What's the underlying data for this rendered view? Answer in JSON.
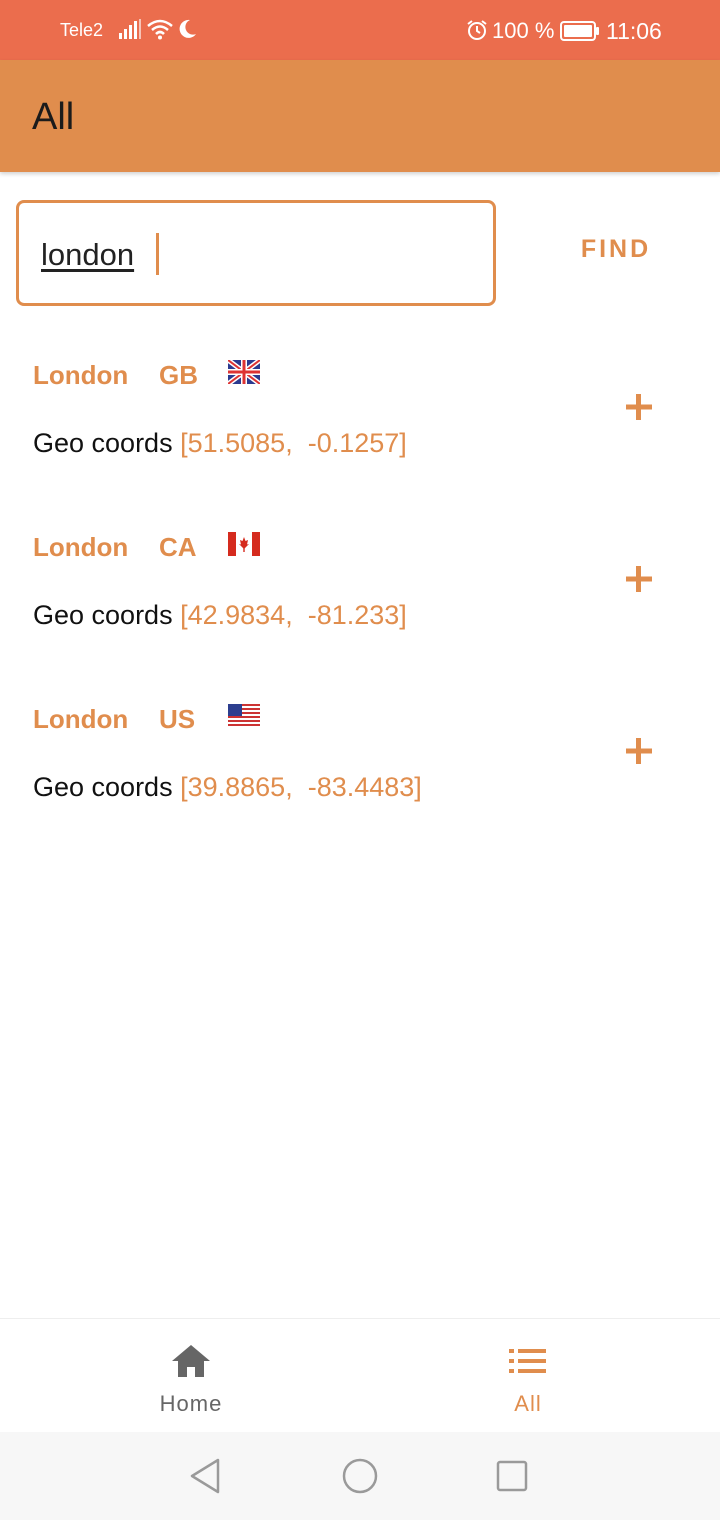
{
  "status_bar": {
    "carrier": "Tele2",
    "battery": "100 %",
    "time": "11:06",
    "icons": [
      "signal-icon",
      "wifi-icon",
      "moon-icon",
      "alarm-icon",
      "battery-icon"
    ]
  },
  "app_bar": {
    "title": "All"
  },
  "search": {
    "value": "london",
    "find_label": "FIND"
  },
  "results": [
    {
      "city": "London",
      "country": "GB",
      "coords_label": "Geo coords",
      "coords": "[51.5085,  -0.1257]",
      "flag": "uk-flag-icon"
    },
    {
      "city": "London",
      "country": "CA",
      "coords_label": "Geo coords",
      "coords": "[42.9834,  -81.233]",
      "flag": "canada-flag-icon"
    },
    {
      "city": "London",
      "country": "US",
      "coords_label": "Geo coords",
      "coords": "[39.8865,  -83.4483]",
      "flag": "us-flag-icon"
    }
  ],
  "bottom_nav": {
    "items": [
      {
        "label": "Home",
        "icon": "home-icon",
        "active": false
      },
      {
        "label": "All",
        "icon": "list-icon",
        "active": true
      }
    ]
  },
  "colors": {
    "status_bar": "#EB6D4D",
    "app_bar": "#E08D4D",
    "accent": "#E08D4D"
  }
}
